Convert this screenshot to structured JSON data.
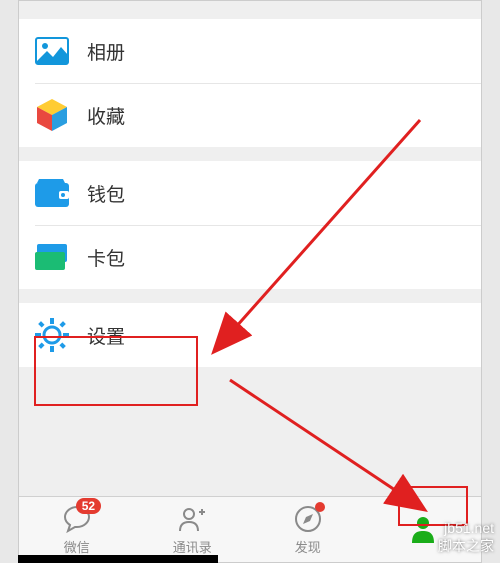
{
  "menu": {
    "album": "相册",
    "favorites": "收藏",
    "wallet": "钱包",
    "cards": "卡包",
    "settings": "设置"
  },
  "tabs": {
    "wechat": {
      "label": "微信",
      "badge": "52"
    },
    "contacts": {
      "label": "通讯录"
    },
    "discover": {
      "label": "发现"
    },
    "me": {
      "label": ""
    }
  },
  "watermark": {
    "line1": "jb51.net",
    "line2": "脚本之家"
  }
}
